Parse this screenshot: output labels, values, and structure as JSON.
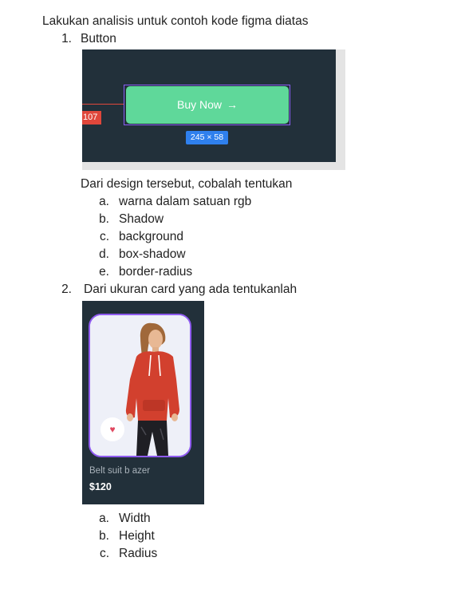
{
  "intro": "Lakukan analisis untuk contoh kode figma diatas",
  "q1": {
    "number": "1.",
    "title": "Button",
    "figure": {
      "button_label": "Buy Now",
      "arrow": "→",
      "spacing_badge": "107",
      "dimension_badge": "245 × 58",
      "colors": {
        "canvas": "#22303a",
        "button": "#5fd89a",
        "outline": "#8a5cf6",
        "guide": "#e0473b",
        "dimension": "#2f80ed"
      }
    },
    "prompt": "Dari design tersebut, cobalah tentukan",
    "items": [
      {
        "marker": "a.",
        "text": "warna dalam satuan rgb"
      },
      {
        "marker": "b.",
        "text": "Shadow"
      },
      {
        "marker": "c.",
        "text": "background"
      },
      {
        "marker": "d.",
        "text": "box-shadow"
      },
      {
        "marker": "e.",
        "text": "border-radius"
      }
    ]
  },
  "q2": {
    "number": "2.",
    "title": "Dari ukuran card yang ada tentukanlah",
    "figure": {
      "product_name": "Belt suit b azer",
      "price": "$120",
      "heart_icon": "heart-icon",
      "colors": {
        "canvas": "#22303a",
        "card_border": "#8f5bf0",
        "heart": "#e0475f",
        "hoodie": "#d2402e"
      }
    },
    "items": [
      {
        "marker": "a.",
        "text": "Width"
      },
      {
        "marker": "b.",
        "text": "Height"
      },
      {
        "marker": "c.",
        "text": "Radius"
      }
    ]
  }
}
